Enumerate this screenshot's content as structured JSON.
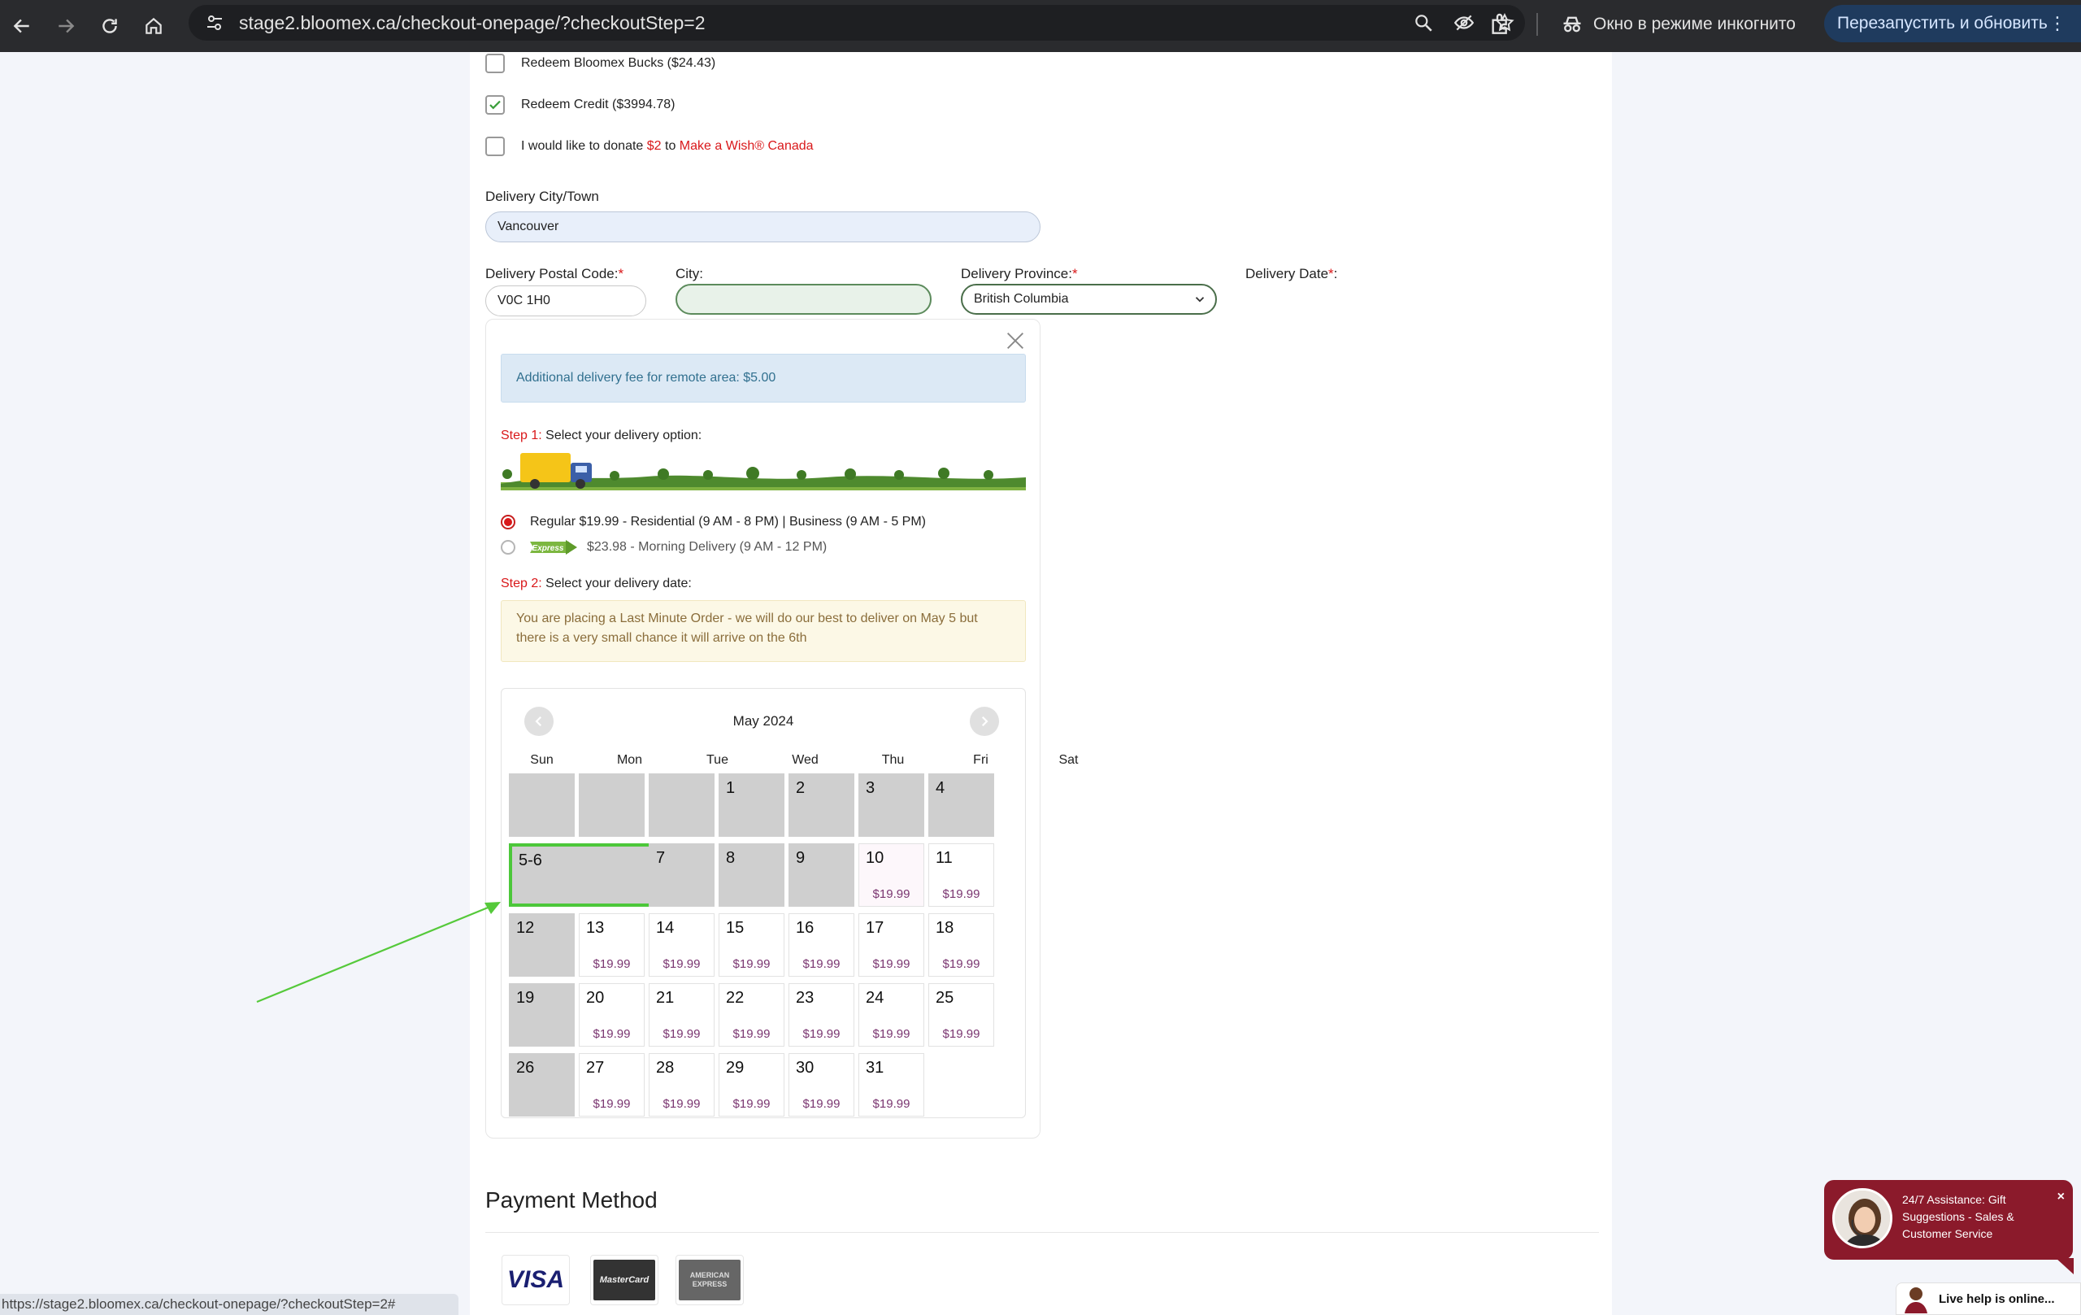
{
  "browser": {
    "url": "stage2.bloomex.ca/checkout-onepage/?checkoutStep=2",
    "incognito_label": "Окно в режиме инкогнито",
    "relaunch_label": "Перезапустить и обновить",
    "status_url": "https://stage2.bloomex.ca/checkout-onepage/?checkoutStep=2#"
  },
  "options": {
    "bucks": "Redeem Bloomex Bucks ($24.43)",
    "credit": "Redeem Credit ($3994.78)",
    "donate_prefix": "I would like to donate ",
    "donate_amount": "$2",
    "donate_mid": " to ",
    "donate_org": "Make a Wish® Canada"
  },
  "form": {
    "city_town_label": "Delivery City/Town",
    "city_town_value": "Vancouver",
    "postal_label": "Delivery Postal Code:",
    "postal_value": "V0C 1H0",
    "city_label": "City:",
    "city_value": "",
    "province_label": "Delivery Province:",
    "province_value": "British Columbia",
    "date_label": "Delivery Date",
    "required_mark": "*",
    "colon": ":"
  },
  "popup": {
    "remote_fee": "Additional delivery fee for remote area: $5.00",
    "step1_prefix": "Step 1:",
    "step1_text": " Select your delivery option:",
    "option_regular": "Regular $19.99 - Residential (9 AM - 8 PM) | Business (9 AM - 5 PM)",
    "option_express_badge": "Express",
    "option_express": "$23.98 - Morning Delivery (9 AM - 12 PM)",
    "step2_prefix": "Step 2:",
    "step2_text": " Select your delivery date:",
    "last_minute": "You are placing a Last Minute Order - we will do our best to deliver on May 5 but there is a very small chance it will arrive on the 6th"
  },
  "calendar": {
    "month": "May 2024",
    "weekdays": [
      "Sun",
      "Mon",
      "Tue",
      "Wed",
      "Thu",
      "Fri",
      "Sat"
    ],
    "price": "$19.99",
    "days": [
      {
        "label": "",
        "status": "off"
      },
      {
        "label": "",
        "status": "off"
      },
      {
        "label": "",
        "status": "off"
      },
      {
        "label": "1",
        "status": "off"
      },
      {
        "label": "2",
        "status": "off"
      },
      {
        "label": "3",
        "status": "off"
      },
      {
        "label": "4",
        "status": "off"
      },
      {
        "label": "5-6",
        "status": "selected"
      },
      {
        "label": "7",
        "status": "off"
      },
      {
        "label": "8",
        "status": "off"
      },
      {
        "label": "9",
        "status": "off"
      },
      {
        "label": "10",
        "status": "available",
        "price": "$19.99"
      },
      {
        "label": "11",
        "status": "available",
        "price": "$19.99"
      },
      {
        "label": "12",
        "status": "off"
      },
      {
        "label": "13",
        "status": "available",
        "price": "$19.99"
      },
      {
        "label": "14",
        "status": "available",
        "price": "$19.99"
      },
      {
        "label": "15",
        "status": "available",
        "price": "$19.99"
      },
      {
        "label": "16",
        "status": "available",
        "price": "$19.99"
      },
      {
        "label": "17",
        "status": "available",
        "price": "$19.99"
      },
      {
        "label": "18",
        "status": "available",
        "price": "$19.99"
      },
      {
        "label": "19",
        "status": "off"
      },
      {
        "label": "20",
        "status": "available",
        "price": "$19.99"
      },
      {
        "label": "21",
        "status": "available",
        "price": "$19.99"
      },
      {
        "label": "22",
        "status": "available",
        "price": "$19.99"
      },
      {
        "label": "23",
        "status": "available",
        "price": "$19.99"
      },
      {
        "label": "24",
        "status": "available",
        "price": "$19.99"
      },
      {
        "label": "25",
        "status": "available",
        "price": "$19.99"
      },
      {
        "label": "26",
        "status": "off"
      },
      {
        "label": "27",
        "status": "available",
        "price": "$19.99"
      },
      {
        "label": "28",
        "status": "available",
        "price": "$19.99"
      },
      {
        "label": "29",
        "status": "available",
        "price": "$19.99"
      },
      {
        "label": "30",
        "status": "available",
        "price": "$19.99"
      },
      {
        "label": "31",
        "status": "available",
        "price": "$19.99"
      }
    ]
  },
  "payment": {
    "title": "Payment Method",
    "cards": [
      "VISA",
      "MasterCard",
      "AMERICAN EXPRESS"
    ]
  },
  "chat": {
    "assist": "24/7 Assistance: Gift Suggestions - Sales & Customer Service",
    "close": "×",
    "live_help": "Live help is online..."
  },
  "colors": {
    "accent_red": "#d9181a",
    "selected_green": "#4cc73a",
    "price_purple": "#7a3570",
    "chat_bg": "#8b1a2b"
  }
}
